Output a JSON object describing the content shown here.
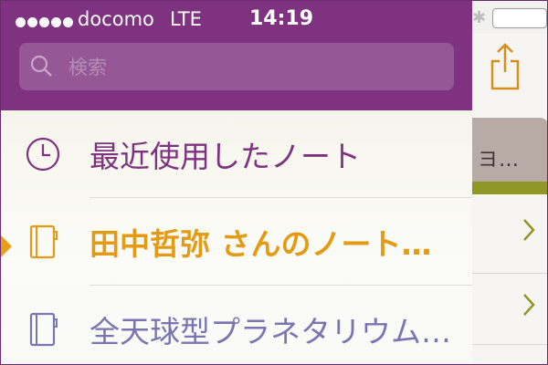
{
  "status_bar": {
    "carrier": "docomo",
    "network": "LTE",
    "time": "14:19",
    "signal_dots": 5
  },
  "search": {
    "placeholder": "検索",
    "value": ""
  },
  "menu": [
    {
      "label": "最近使用したノート",
      "icon": "clock-icon",
      "color": "#7e327f",
      "selected": false
    },
    {
      "label": "田中哲弥 さんのノート…",
      "icon": "notebook-icon",
      "color": "#e39b15",
      "selected": true
    },
    {
      "label": "全天球型プラネタリウム…",
      "icon": "notebook-icon",
      "color": "#7a75b0",
      "selected": false
    }
  ],
  "background_screen": {
    "card_text": "ヨ…",
    "icons": [
      "bluetooth-icon",
      "battery-icon",
      "share-icon",
      "chevron-right-icon"
    ]
  },
  "colors": {
    "brand_purple": "#7e327f",
    "accent_orange": "#e39b15",
    "lavender": "#7a75b0",
    "olive": "#8f9726"
  }
}
